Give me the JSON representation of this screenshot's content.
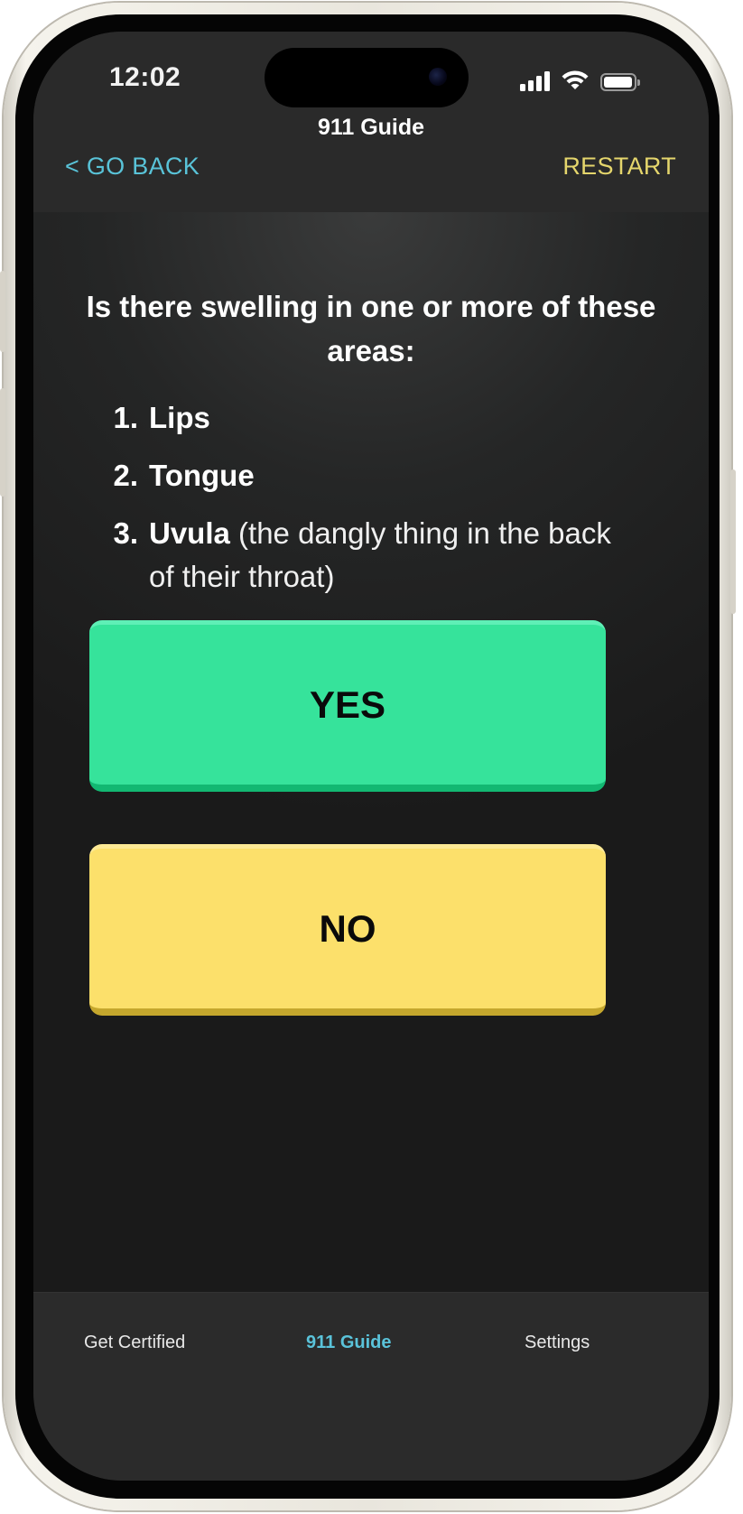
{
  "status_bar": {
    "time": "12:02"
  },
  "header": {
    "title": "911 Guide",
    "back_label": "< GO BACK",
    "restart_label": "RESTART"
  },
  "question": {
    "text": "Is there swelling in one or more of these areas:"
  },
  "areas": [
    {
      "number": "1.",
      "term": "Lips",
      "description": ""
    },
    {
      "number": "2.",
      "term": "Tongue",
      "description": ""
    },
    {
      "number": "3.",
      "term": "Uvula",
      "description": " (the dangly thing in the back of their throat)"
    }
  ],
  "answers": {
    "yes_label": "YES",
    "no_label": "NO"
  },
  "tabs": [
    {
      "label": "Get Certified",
      "active": false
    },
    {
      "label": "911 Guide",
      "active": true
    },
    {
      "label": "Settings",
      "active": false
    }
  ],
  "colors": {
    "accent_back": "#59c3d8",
    "accent_restart": "#e5d66c",
    "yes_button": "#36e39b",
    "no_button": "#fce06b",
    "active_tab": "#5ac3da"
  }
}
